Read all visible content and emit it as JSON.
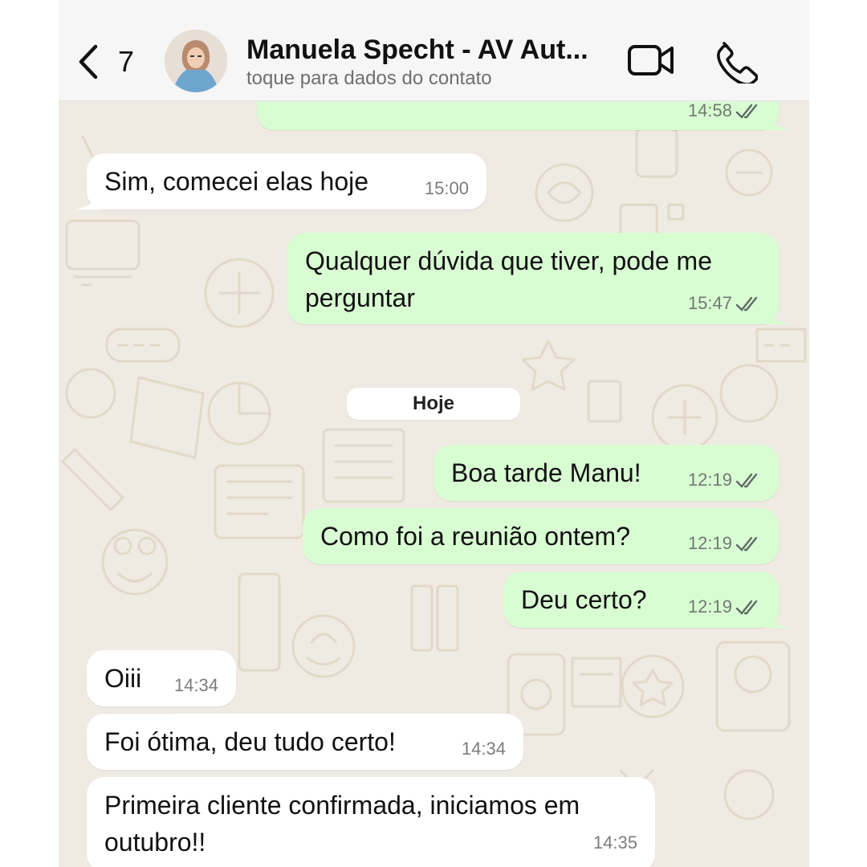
{
  "header": {
    "back_count": "7",
    "contact_name": "Manuela Specht - AV Aut...",
    "subtitle": "toque para dados do contato"
  },
  "day_separator": "Hoje",
  "messages": [
    {
      "dir": "out",
      "text": "",
      "time": "14:58",
      "read": true
    },
    {
      "dir": "in",
      "text": "Sim, comecei elas hoje",
      "time": "15:00"
    },
    {
      "dir": "out",
      "text": "Qualquer dúvida que tiver, pode me\nperguntar",
      "time": "15:47",
      "read": true
    },
    {
      "dir": "out",
      "text": "Boa tarde Manu!",
      "time": "12:19",
      "read": true
    },
    {
      "dir": "out",
      "text": "Como foi a reunião ontem?",
      "time": "12:19",
      "read": true
    },
    {
      "dir": "out",
      "text": "Deu certo?",
      "time": "12:19",
      "read": true
    },
    {
      "dir": "in",
      "text": "Oiii",
      "time": "14:34"
    },
    {
      "dir": "in",
      "text": "Foi ótima, deu tudo certo!",
      "time": "14:34"
    },
    {
      "dir": "in",
      "text": "Primeira cliente confirmada, iniciamos em\noutubro!!",
      "time": "14:35"
    }
  ],
  "icons": {
    "back": "chevron-left-icon",
    "video": "video-camera-icon",
    "call": "phone-icon",
    "read_receipt": "double-check-icon"
  },
  "colors": {
    "outgoing_bubble": "#d9fdd3",
    "incoming_bubble": "#ffffff",
    "chat_background": "#efeae2",
    "read_ticks": "#5f6b66"
  }
}
